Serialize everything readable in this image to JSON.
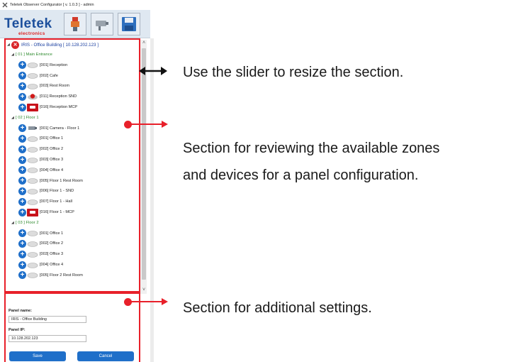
{
  "window": {
    "title": "Teletek Observer Configurator [ v. 1.0.3 ] - admin",
    "logo_word": "Teletek",
    "logo_sub": "electronics",
    "toolbar": [
      "panel-icon",
      "camera-icon",
      "save-icon"
    ]
  },
  "tree": {
    "root": "IRIS - Office Building [ 10.128.202.123 ]",
    "rows": [
      {
        "kind": "group",
        "label": "[ 01 ] Main Entrance"
      },
      {
        "kind": "detector",
        "label": "[001] Reception"
      },
      {
        "kind": "detector",
        "label": "[002] Cafe"
      },
      {
        "kind": "detector",
        "label": "[003] Rest Room"
      },
      {
        "kind": "sounder",
        "label": "[011] Reception SND"
      },
      {
        "kind": "mcp",
        "label": "[016] Reception MCP"
      },
      {
        "kind": "group",
        "label": "[ 02 ] Floor 1"
      },
      {
        "kind": "camera",
        "label": "[001] Camera - Floor 1"
      },
      {
        "kind": "detector",
        "label": "[001] Office 1"
      },
      {
        "kind": "detector",
        "label": "[002] Office 2"
      },
      {
        "kind": "detector",
        "label": "[003] Office 3"
      },
      {
        "kind": "detector",
        "label": "[004] Office 4"
      },
      {
        "kind": "detector",
        "label": "[005] Floor 1 Rest Room"
      },
      {
        "kind": "detector",
        "label": "[006] Floor 1 - SND"
      },
      {
        "kind": "detector",
        "label": "[007] Floor 1 - Hall"
      },
      {
        "kind": "mcp",
        "label": "[016] Floor 1 - MCP"
      },
      {
        "kind": "group",
        "label": "[ 03 ] Floor 2"
      },
      {
        "kind": "detector",
        "label": "[001] Office 1"
      },
      {
        "kind": "detector",
        "label": "[002] Office 2"
      },
      {
        "kind": "detector",
        "label": "[003] Office 3"
      },
      {
        "kind": "detector",
        "label": "[004] Office 4"
      },
      {
        "kind": "detector",
        "label": "[005] Floor 2 Rest Room"
      }
    ]
  },
  "settings": {
    "panel_name_label": "Panel name:",
    "panel_name_value": "IRIS - Office Building",
    "panel_ip_label": "Panel IP:",
    "panel_ip_value": "10.128.202.123",
    "save_label": "Save",
    "cancel_label": "Cancel"
  },
  "annotations": {
    "slider": "Use the slider to resize the section.",
    "section_line1": "Section for reviewing the available zones",
    "section_line2": "and devices for a panel configuration.",
    "settings": "Section for additional settings."
  },
  "colors": {
    "accent": "#1f6fc9",
    "annotation_red": "#e8202a",
    "group_green": "#2e8a2e",
    "root_blue": "#1a3fa0"
  }
}
